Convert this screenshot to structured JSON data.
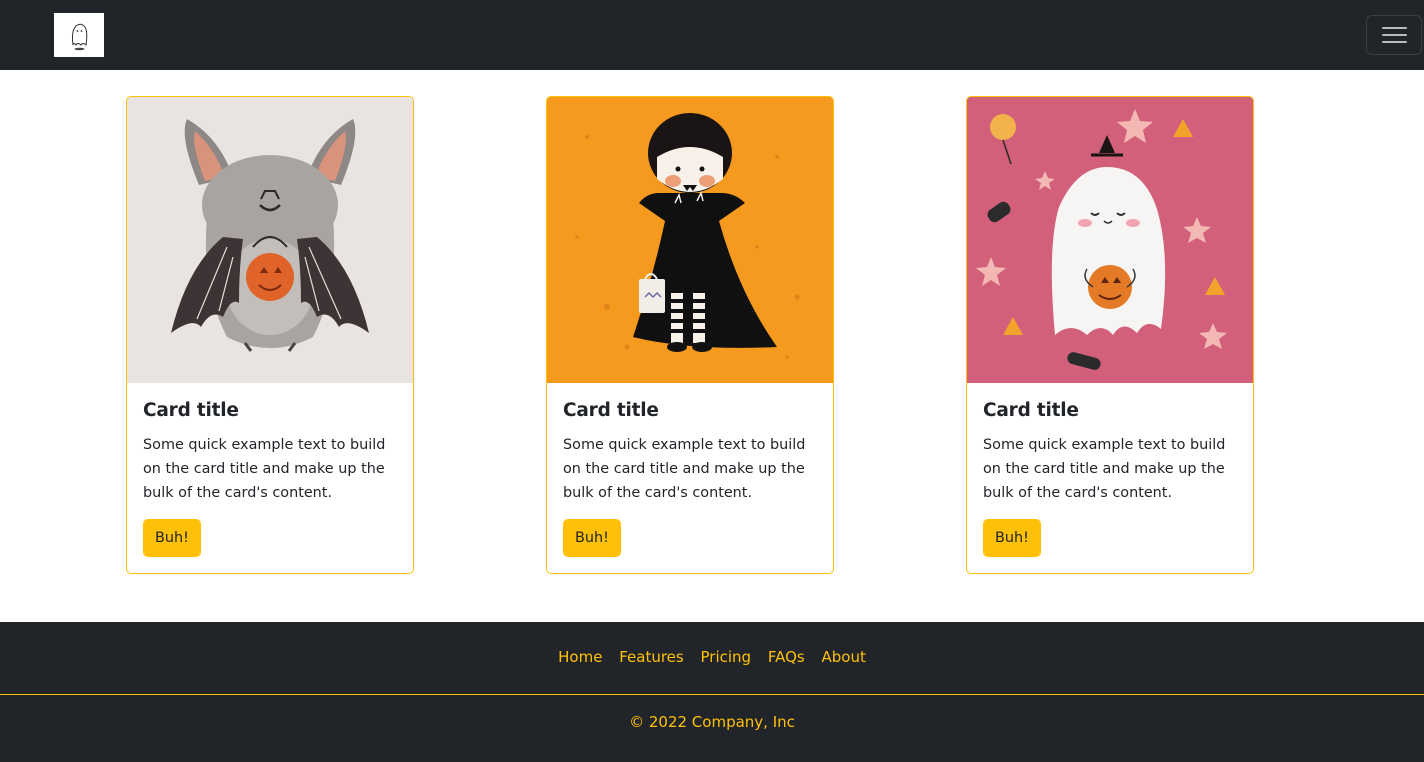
{
  "navbar": {
    "logo": "ghost-logo-icon",
    "toggle": "hamburger-menu-icon"
  },
  "cards": [
    {
      "image": "bat-illustration",
      "title": "Card title",
      "text": "Some quick example text to build on the card title and make up the bulk of the card's content.",
      "button": "Buh!"
    },
    {
      "image": "vampire-illustration",
      "title": "Card title",
      "text": "Some quick example text to build on the card title and make up the bulk of the card's content.",
      "button": "Buh!"
    },
    {
      "image": "ghost-illustration",
      "title": "Card title",
      "text": "Some quick example text to build on the card title and make up the bulk of the card's content.",
      "button": "Buh!"
    }
  ],
  "footer": {
    "links": [
      "Home",
      "Features",
      "Pricing",
      "FAQs",
      "About"
    ],
    "copyright": "© 2022 Company, Inc"
  },
  "colors": {
    "dark": "#212529",
    "accent": "#ffc107",
    "bat_bg": "#e9e4e1",
    "vampire_bg": "#f59a1e",
    "ghost_bg": "#d2607a"
  }
}
